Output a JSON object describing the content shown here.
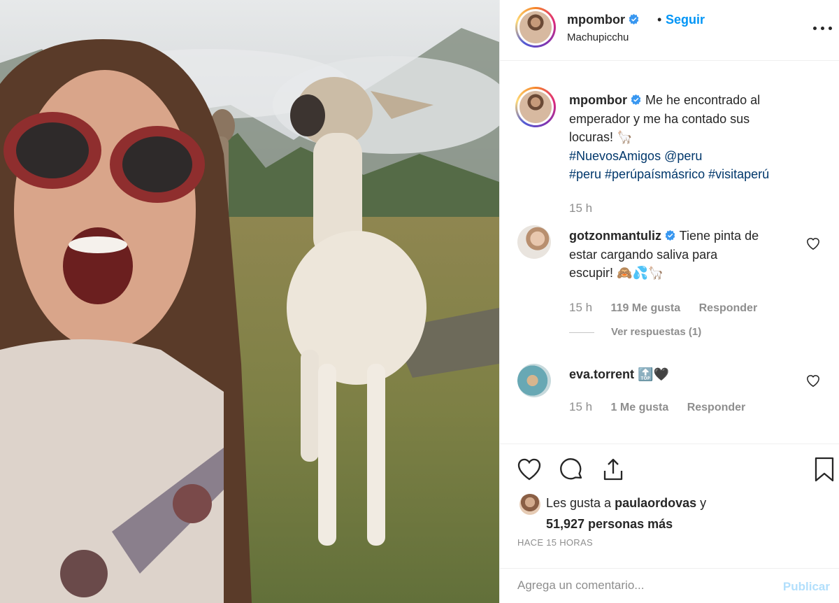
{
  "header": {
    "username": "mpombor",
    "separator": "•",
    "follow_label": "Seguir",
    "location": "Machupicchu"
  },
  "caption": {
    "username": "mpombor",
    "line1": "Me he encontrado al",
    "line2": "emperador y me ha contado sus",
    "line3": "locuras!",
    "line3_emoji": "🦙",
    "hashtag_line1": "#NuevosAmigos @peru",
    "hashtag_line2": "#peru #perúpaísmásrico #visitaperú",
    "time": "15 h"
  },
  "comments": [
    {
      "username": "gotzonmantuliz",
      "line1": "Tiene pinta de",
      "line2": "estar cargando saliva para",
      "line3": "escupir!",
      "emojis": "🙈💦🦙",
      "time": "15 h",
      "likes": "119 Me gusta",
      "reply_label": "Responder",
      "view_replies": "Ver respuestas (1)"
    },
    {
      "username": "eva.torrent",
      "text": "🔝🖤",
      "time": "15 h",
      "likes": "1 Me gusta",
      "reply_label": "Responder"
    }
  ],
  "likes": {
    "prefix": "Les gusta a",
    "user": "paulaordovas",
    "conj": "y",
    "count": "51,927 personas más"
  },
  "time_ago": "HACE 15 HORAS",
  "comment_box": {
    "placeholder": "Agrega un comentario...",
    "publish_label": "Publicar"
  },
  "colors": {
    "accent": "#0095f6",
    "muted": "#8e8e8e",
    "hashtag": "#00376b",
    "publish_disabled": "#b2dffc"
  },
  "icons": [
    "verified-badge-icon",
    "more-options-icon",
    "heart-icon",
    "comment-icon",
    "share-icon",
    "bookmark-icon"
  ]
}
